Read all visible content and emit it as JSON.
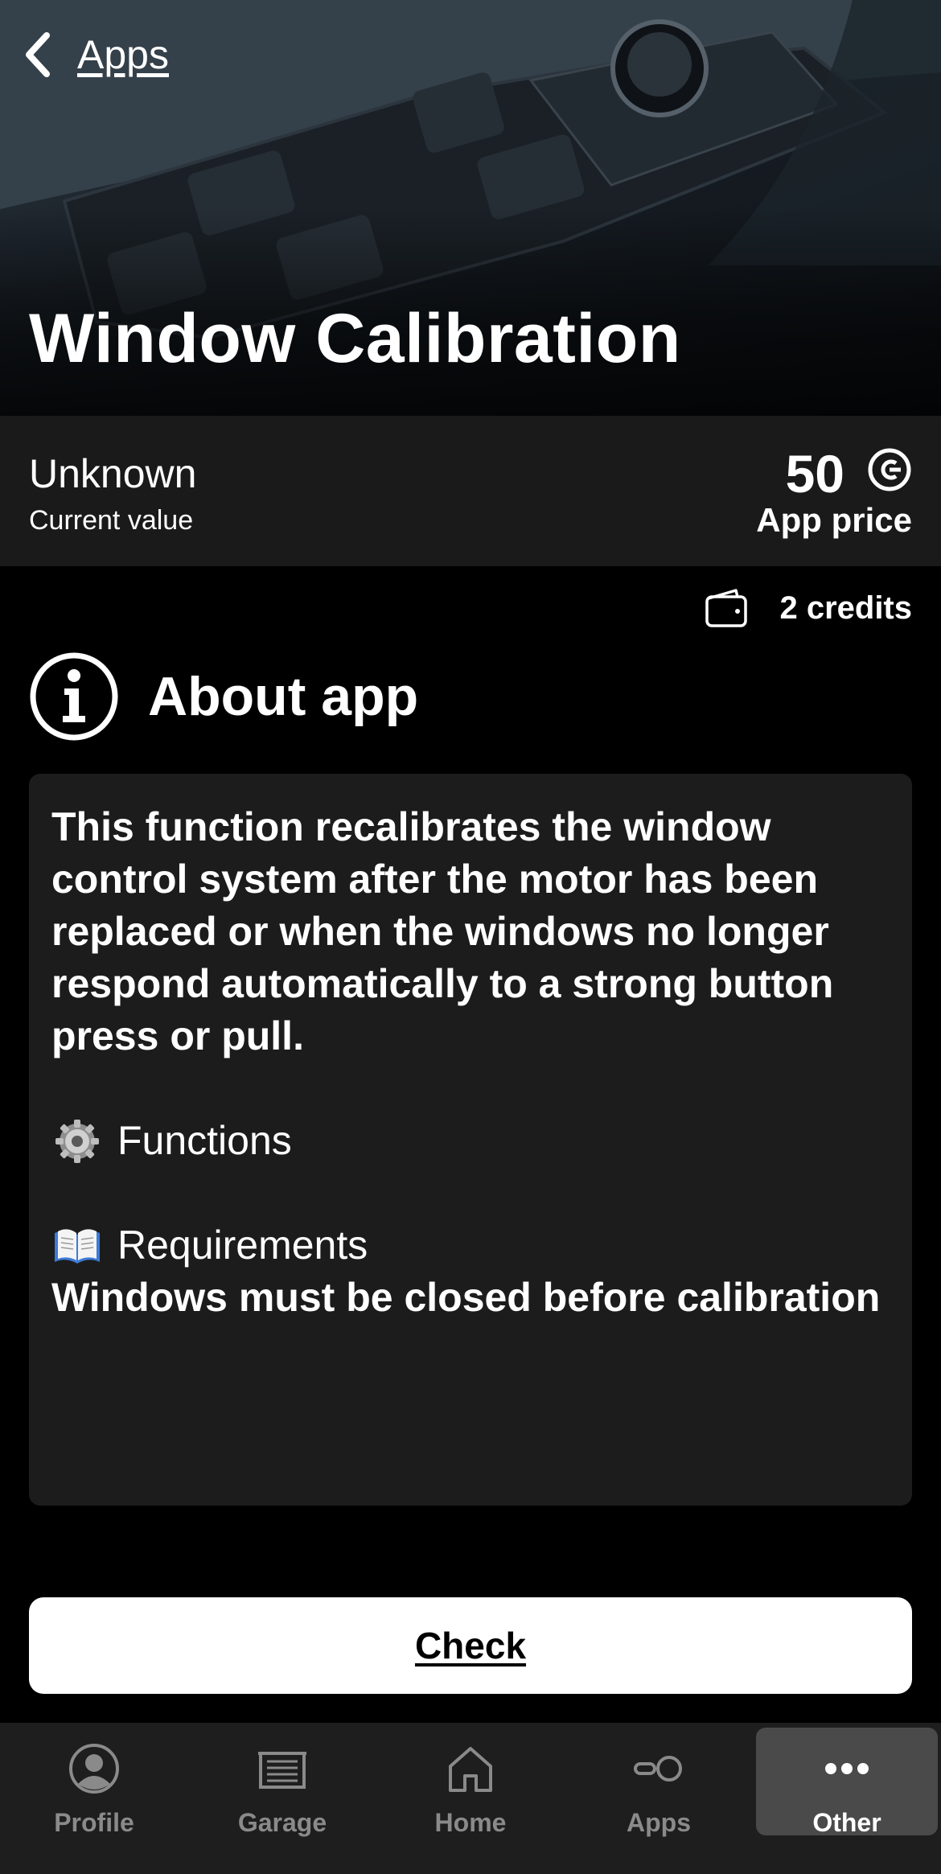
{
  "header": {
    "back_label": "Apps",
    "title": "Window Calibration"
  },
  "value": {
    "current": "Unknown",
    "current_label": "Current value",
    "price": "50",
    "price_label": "App price"
  },
  "credits": {
    "text": "2 credits"
  },
  "about": {
    "title": "About app",
    "description": "This function recalibrates the window control system after the motor has been replaced or when the windows no longer respond automatically to a strong button press or pull.",
    "functions_label": "Functions",
    "requirements_label": "Requirements",
    "requirements_text": "Windows must be closed before calibration"
  },
  "actions": {
    "check_label": "Check"
  },
  "tabs": [
    {
      "label": "Profile",
      "icon": "profile-icon"
    },
    {
      "label": "Garage",
      "icon": "garage-icon"
    },
    {
      "label": "Home",
      "icon": "home-icon"
    },
    {
      "label": "Apps",
      "icon": "apps-icon"
    },
    {
      "label": "Other",
      "icon": "more-icon",
      "active": true
    }
  ],
  "colors": {
    "background": "#000000",
    "card": "#1c1c1c",
    "value_bar": "#1a1a1a",
    "tab_bar": "#1e1e1e",
    "tab_active": "#4a4a4a",
    "tab_inactive_text": "#8a8a8a"
  }
}
